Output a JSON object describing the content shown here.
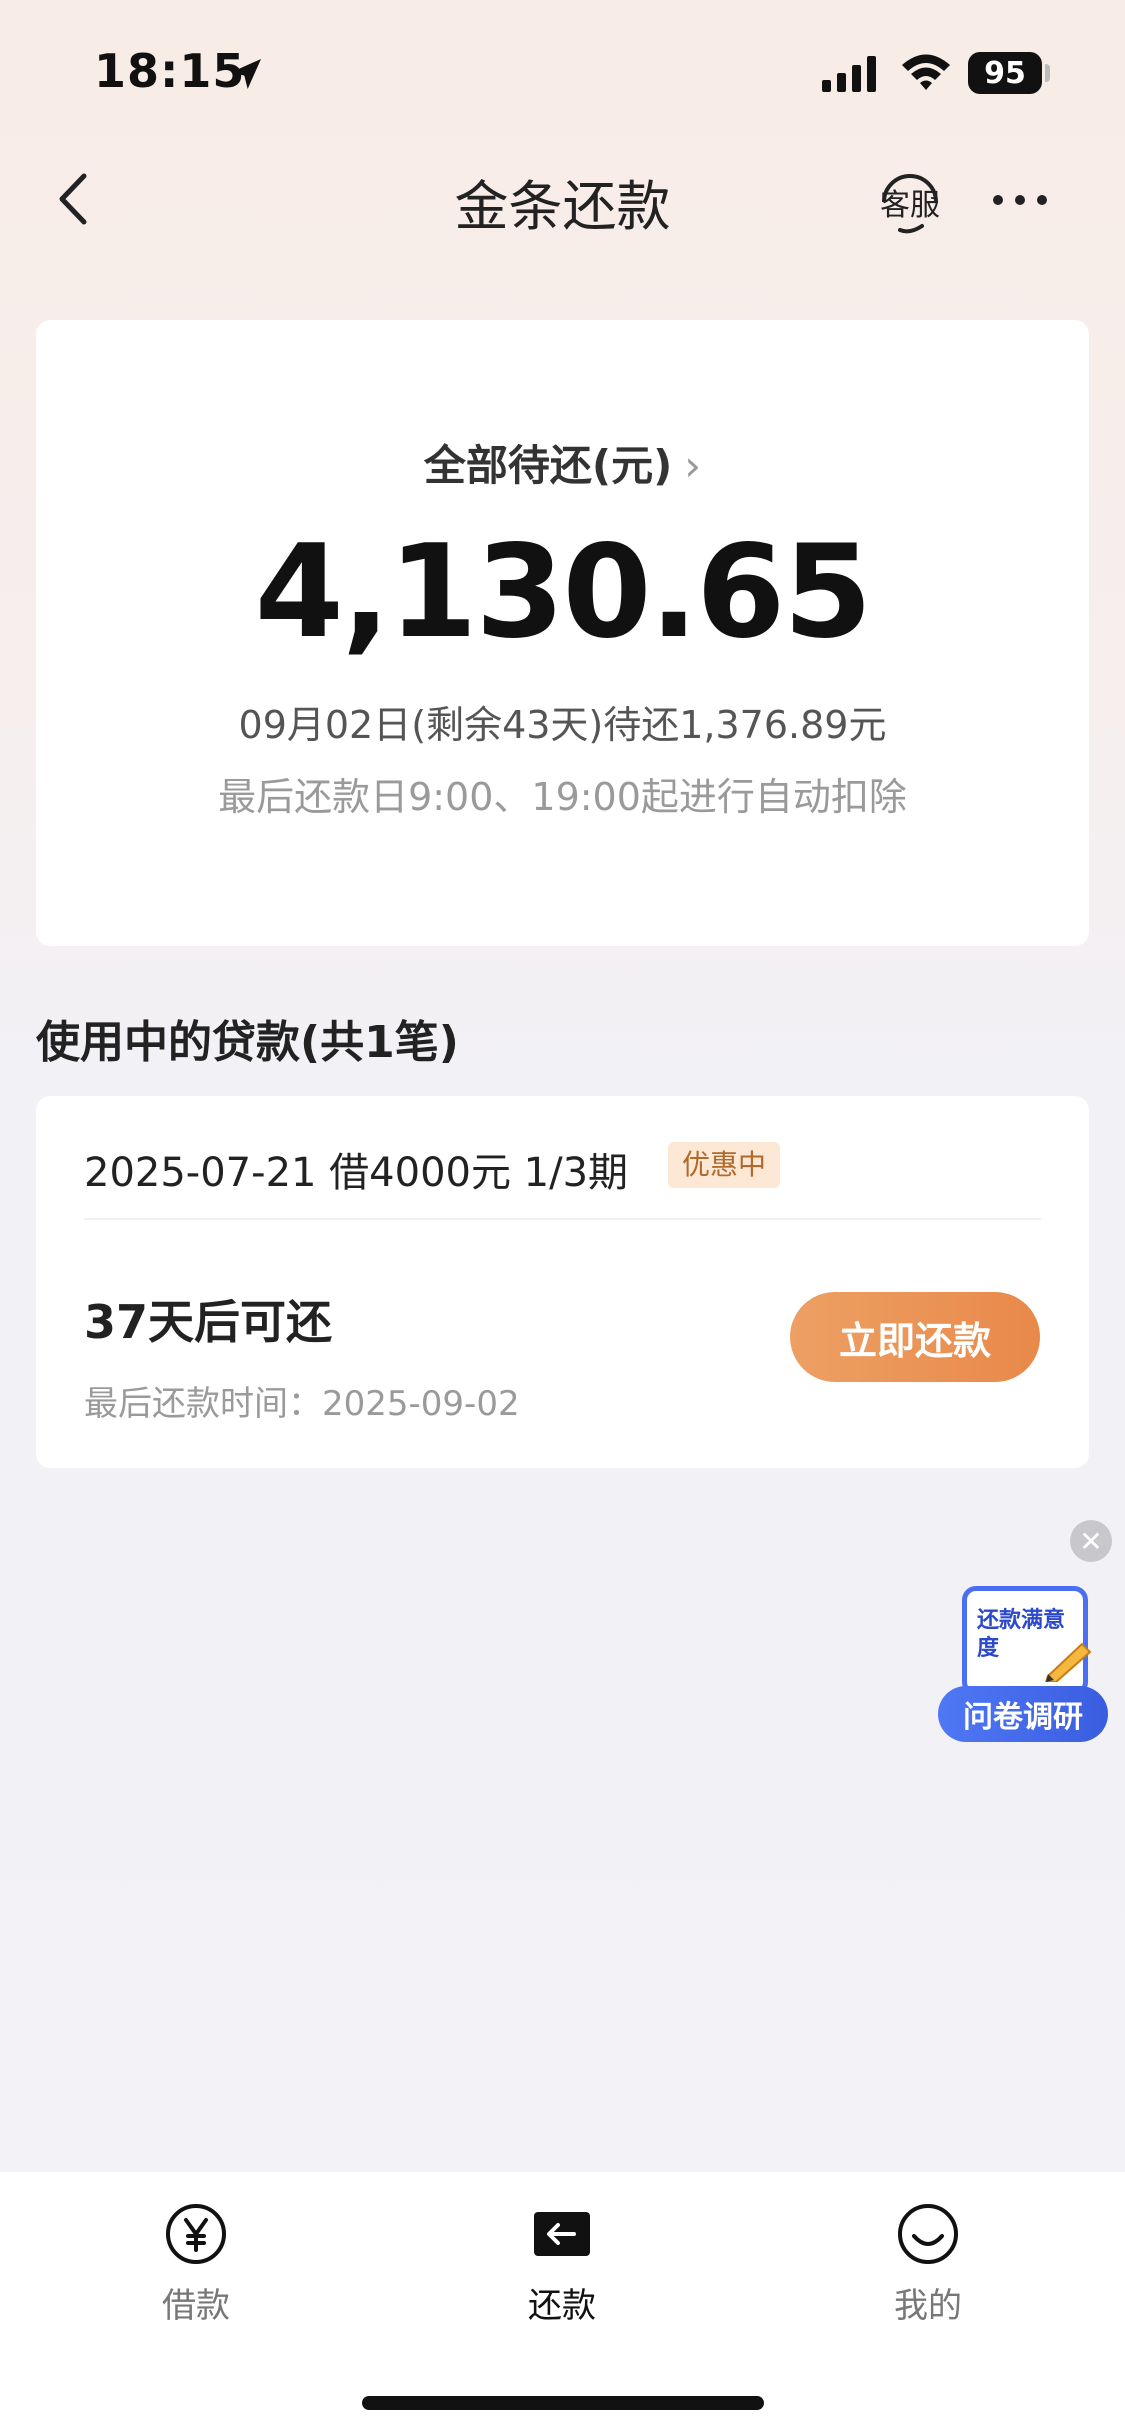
{
  "status_bar": {
    "time": "18:15",
    "battery": "95"
  },
  "nav": {
    "title": "金条还款",
    "service_label": "客服"
  },
  "summary": {
    "label": "全部待还(元)",
    "chevron": "›",
    "amount": "4,130.65",
    "due_line": "09月02日(剩余43天)待还1,376.89元",
    "auto_line": "最后还款日9:00、19:00起进行自动扣除"
  },
  "section": {
    "title": "使用中的贷款(共1笔)"
  },
  "loan": {
    "header": "2025-07-21 借4000元 1/3期",
    "badge": "优惠中",
    "repay_status": "37天后可还",
    "last_date": "最后还款时间：2025-09-02",
    "button_label": "立即还款"
  },
  "survey": {
    "close": "✕",
    "card_text": "还款满意度",
    "pill_label": "问卷调研"
  },
  "tabbar": {
    "tabs": [
      {
        "label": "借款",
        "icon": "yen-circle-icon"
      },
      {
        "label": "还款",
        "icon": "return-arrow-icon"
      },
      {
        "label": "我的",
        "icon": "smile-face-icon"
      }
    ],
    "active_index": 1
  },
  "colors": {
    "accent": "#E8894A",
    "badge_bg": "#FDE8D6",
    "survey_blue": "#4A6FF0"
  }
}
